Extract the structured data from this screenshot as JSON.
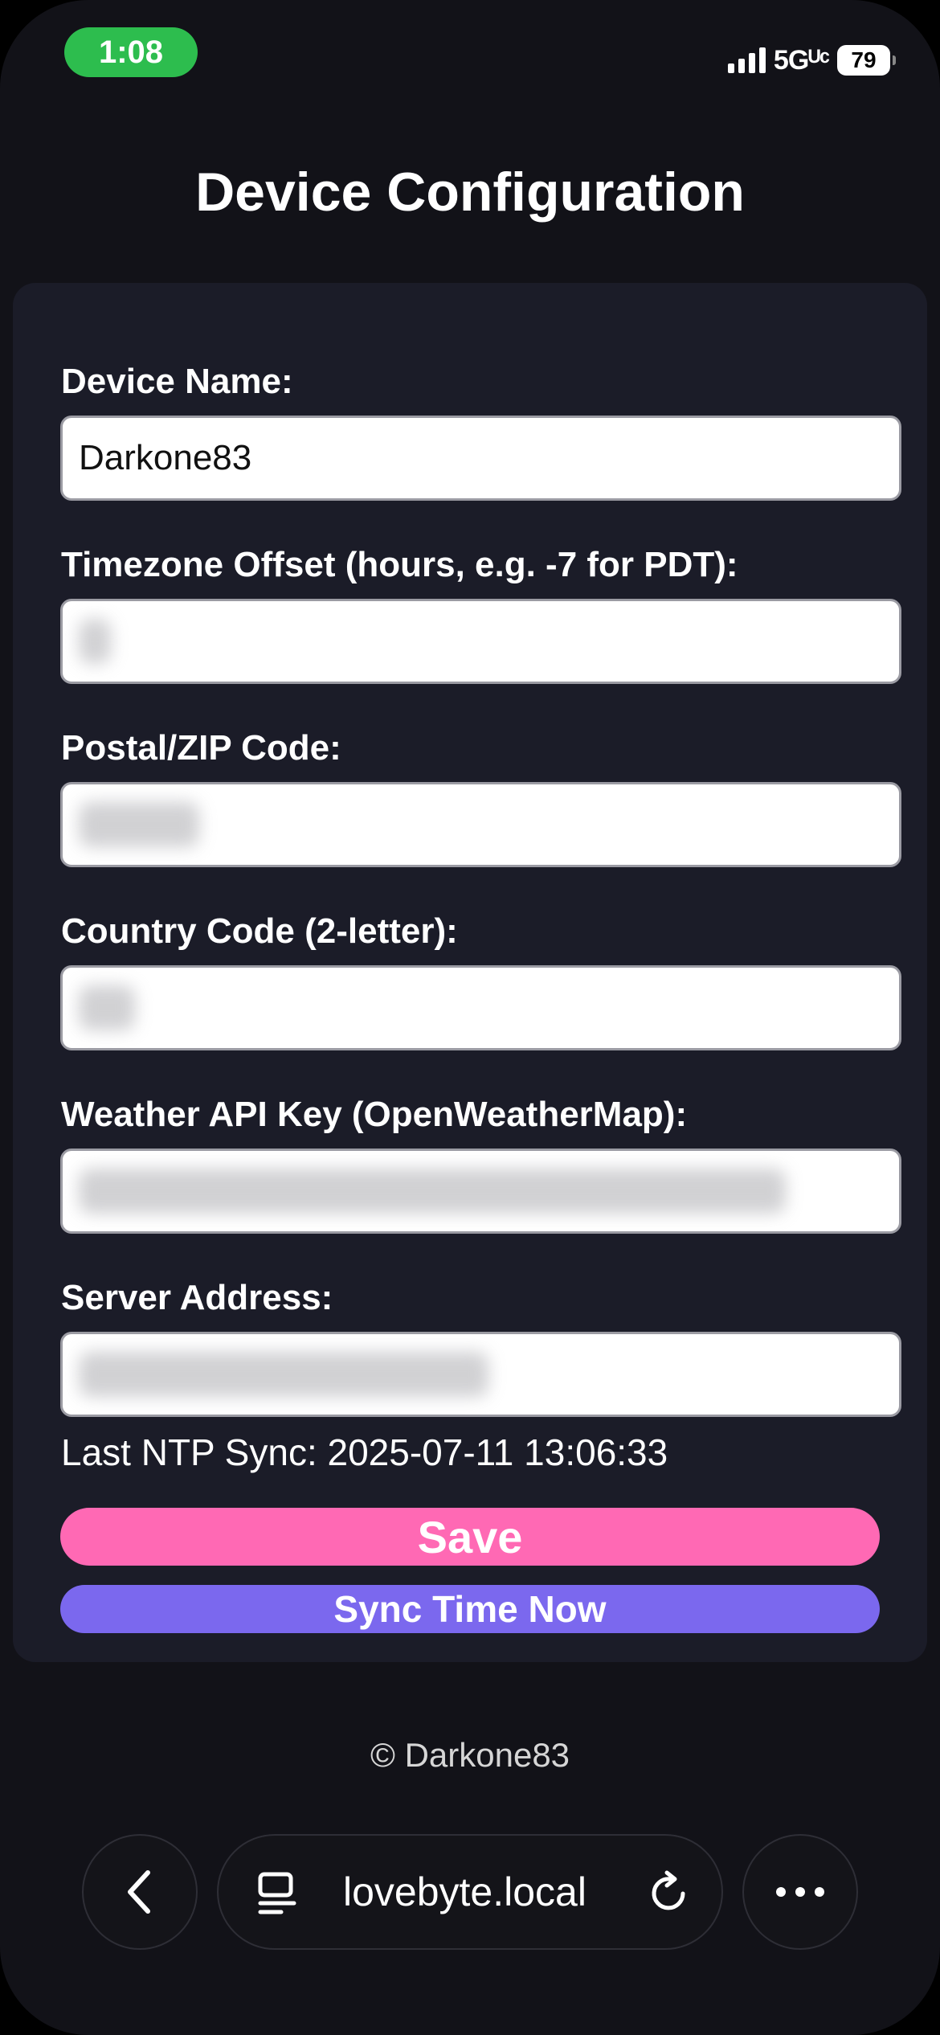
{
  "status_bar": {
    "time": "1:08",
    "network": "5Gᵁᶜ",
    "battery": "79"
  },
  "page": {
    "title": "Device Configuration"
  },
  "form": {
    "device_name": {
      "label": "Device Name:",
      "value": "Darkone83"
    },
    "timezone": {
      "label": "Timezone Offset (hours, e.g. -7 for PDT):"
    },
    "postal": {
      "label": "Postal/ZIP Code:"
    },
    "country": {
      "label": "Country Code (2-letter):"
    },
    "api_key": {
      "label": "Weather API Key (OpenWeatherMap):"
    },
    "server": {
      "label": "Server Address:"
    },
    "last_sync": "Last NTP Sync: 2025-07-11 13:06:33",
    "save_label": "Save",
    "sync_label": "Sync Time Now"
  },
  "footer": {
    "copyright": "© Darkone83"
  },
  "browser": {
    "url": "lovebyte.local",
    "icons": [
      "back-icon",
      "tabs-icon",
      "reload-icon",
      "more-icon"
    ]
  },
  "colors": {
    "background": "#121218",
    "card": "#1b1c28",
    "save_button": "#ff69b4",
    "sync_button": "#7b68ee",
    "time_pill": "#2dbd4e"
  }
}
